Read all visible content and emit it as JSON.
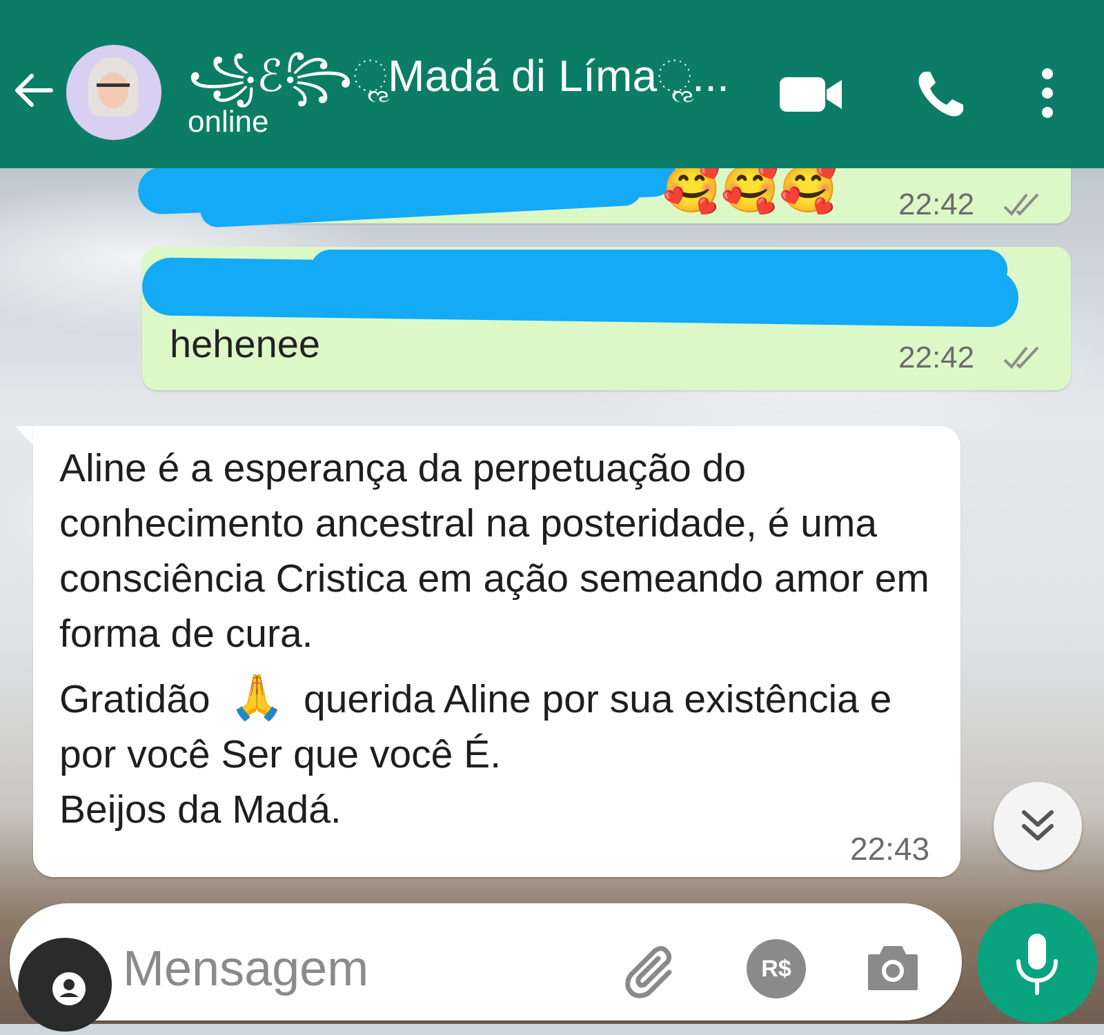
{
  "header": {
    "contact_name": "꧁ℰ꧂ૢMadá di Límaૢ...",
    "status": "online"
  },
  "messages": {
    "outgoing": [
      {
        "emojis": "🥰🥰🥰",
        "time": "22:42"
      },
      {
        "text": "hehenee",
        "time": "22:42"
      }
    ],
    "incoming": {
      "paragraph1": "Aline é a esperança da perpetuação do conhecimento ancestral na posteridade, é uma consciência Cristica em ação semeando amor em forma de cura.",
      "paragraph2_before_emoji": "Gratidão",
      "paragraph2_emoji": "🙏",
      "paragraph2_after_emoji": "querida Aline por sua existência e por você Ser que você É.",
      "signoff": "Beijos da Madá.",
      "time": "22:43"
    }
  },
  "input": {
    "placeholder": "Mensagem",
    "pay_label": "R$"
  },
  "colors": {
    "header": "#0b7d66",
    "outgoing_bubble": "#dcf8c6",
    "mic_button": "#0aa37f",
    "redaction": "#14aaf5"
  }
}
